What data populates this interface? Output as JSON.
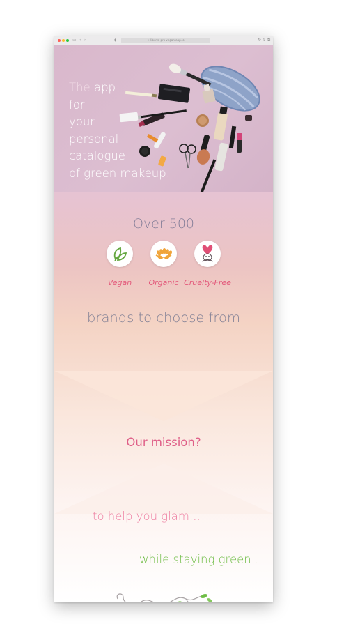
{
  "browser": {
    "address": "☆ liberte-pro-vegan-app.io"
  },
  "hero": {
    "word_the": "The",
    "word_app": "app",
    "line_for": "for",
    "line_your": "your",
    "line_personal": "personal",
    "line_catalogue": "catalogue",
    "line_green": "of green makeup."
  },
  "stats": {
    "headline": "Over 500",
    "badges": [
      {
        "label": "Vegan",
        "icon": "leaf-icon"
      },
      {
        "label": "Organic",
        "icon": "wheat-icon"
      },
      {
        "label": "Cruelty-Free",
        "icon": "bunny-heart-icon"
      }
    ],
    "subline": "brands to choose from"
  },
  "mission": {
    "question": "Our mission?",
    "answer_1": "to help you glam...",
    "answer_2": "while staying green ."
  },
  "colors": {
    "pink_accent": "#e35a7b",
    "green_accent": "#6fbd46",
    "muted_text": "#858397"
  }
}
